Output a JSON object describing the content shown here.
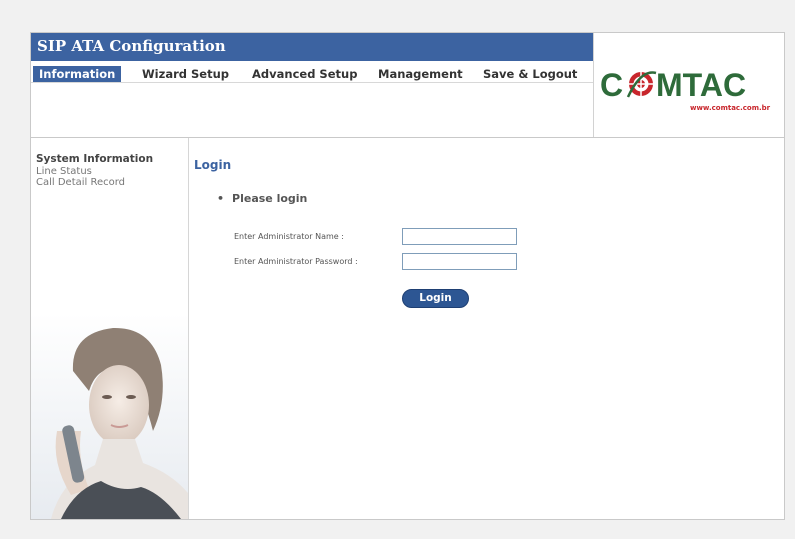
{
  "app": {
    "title": "SIP ATA Configuration"
  },
  "tabs": [
    {
      "label": "Information",
      "active": true
    },
    {
      "label": "Wizard Setup",
      "active": false
    },
    {
      "label": "Advanced Setup",
      "active": false
    },
    {
      "label": "Management",
      "active": false
    },
    {
      "label": "Save & Logout",
      "active": false
    }
  ],
  "logo": {
    "text_left": "C",
    "text_right": "MTAC",
    "url": "www.comtac.com.br"
  },
  "sidebar": {
    "items": [
      {
        "label": "System Information",
        "bold": true
      },
      {
        "label": "Line Status",
        "bold": false
      },
      {
        "label": "Call Detail Record",
        "bold": false
      }
    ]
  },
  "main": {
    "heading": "Login",
    "bullet": "Please login",
    "fields": [
      {
        "label": "Enter Administrator Name :",
        "value": "",
        "placeholder": ""
      },
      {
        "label": "Enter Administrator Password :",
        "value": "",
        "placeholder": ""
      }
    ],
    "login_button": "Login"
  },
  "colors": {
    "brand_blue": "#3c63a1",
    "logo_green": "#2e6b3a",
    "logo_red": "#c8262c",
    "button_blue": "#2d5693"
  },
  "icons": {
    "logo_mark": "globe-target-icon",
    "bullet": "bullet-dot-icon"
  }
}
